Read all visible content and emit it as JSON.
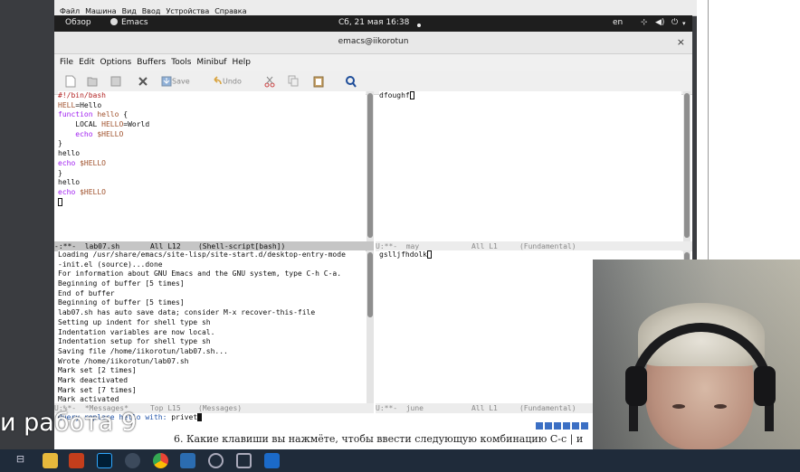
{
  "vm_menu": [
    "Файл",
    "Машина",
    "Вид",
    "Ввод",
    "Устройства",
    "Справка"
  ],
  "gnome": {
    "overview": "Обзор",
    "app": "Emacs",
    "datetime": "Сб, 21 мая  16:38",
    "lang": "en"
  },
  "window": {
    "title": "emacs@iikorotun",
    "close": "×"
  },
  "menu": [
    "File",
    "Edit",
    "Options",
    "Buffers",
    "Tools",
    "Minibuf",
    "Help"
  ],
  "toolbar": {
    "save": "Save",
    "undo": "Undo"
  },
  "pane_tl": {
    "lines": [
      [
        {
          "t": "#!/bin/bash",
          "c": "cm"
        }
      ],
      [
        {
          "t": "HELL",
          "c": "var"
        },
        {
          "t": "=Hello",
          "c": ""
        }
      ],
      [
        {
          "t": "function",
          "c": "kw"
        },
        {
          "t": " ",
          "c": ""
        },
        {
          "t": "hello",
          "c": "var"
        },
        {
          "t": " {",
          "c": ""
        }
      ],
      [
        {
          "t": "    LOCAL ",
          "c": ""
        },
        {
          "t": "HELLO",
          "c": "var"
        },
        {
          "t": "=World",
          "c": ""
        }
      ],
      [
        {
          "t": "    ",
          "c": ""
        },
        {
          "t": "echo",
          "c": "kw"
        },
        {
          "t": " ",
          "c": ""
        },
        {
          "t": "$HELLO",
          "c": "var"
        }
      ],
      [
        {
          "t": "}",
          "c": ""
        }
      ],
      [
        {
          "t": "hello",
          "c": ""
        }
      ],
      [
        {
          "t": "echo",
          "c": "kw"
        },
        {
          "t": " ",
          "c": ""
        },
        {
          "t": "$HELLO",
          "c": "var"
        }
      ],
      [
        {
          "t": "}",
          "c": ""
        }
      ],
      [
        {
          "t": "hello",
          "c": ""
        }
      ],
      [
        {
          "t": "echo",
          "c": "kw"
        },
        {
          "t": " ",
          "c": ""
        },
        {
          "t": "$HELLO",
          "c": "var"
        }
      ]
    ],
    "modeline": "-:**-  lab07.sh       All L12    (Shell-script[bash])"
  },
  "pane_tr": {
    "text": "dfoughf",
    "modeline": "U:**-  may            All L1     (Fundamental)"
  },
  "pane_bl": {
    "lines": [
      "Loading /usr/share/emacs/site-lisp/site-start.d/desktop-entry-mode",
      "-init.el (source)...done",
      "For information about GNU Emacs and the GNU system, type C-h C-a.",
      "Beginning of buffer [5 times]",
      "End of buffer",
      "Beginning of buffer [5 times]",
      "lab07.sh has auto save data; consider M-x recover-this-file",
      "Setting up indent for shell type sh",
      "Indentation variables are now local.",
      "Indentation setup for shell type sh",
      "Saving file /home/iikorotun/lab07.sh...",
      "Wrote /home/iikorotun/lab07.sh",
      "Mark set [2 times]",
      "Mark deactivated",
      "Mark set [7 times]",
      "Mark activated"
    ],
    "modeline": "U:%*-  *Messages*     Top L15    (Messages)"
  },
  "pane_br": {
    "text": "gslljfhdolk",
    "modeline": "U:**-  june           All L1     (Fundamental)"
  },
  "minibuffer": {
    "prompt": "Query replace hello with: ",
    "value": "privet"
  },
  "slide": {
    "title": "и работа 9",
    "doc_line": "6.  Какие клавиши вы нажмёте, чтобы ввести следующую комбинацию C-c  | и"
  },
  "colors": {
    "keyword": "#a020f0",
    "variable": "#a0522d",
    "comment": "#b22222",
    "taskbar": "#1f2b3a"
  }
}
